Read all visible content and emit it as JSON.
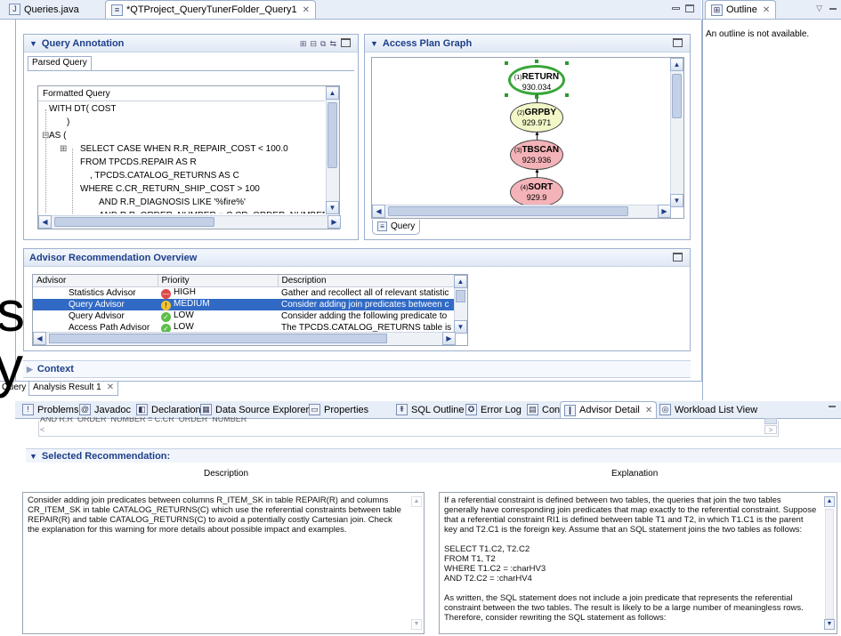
{
  "editor_tabs": [
    {
      "label": "Queries.java",
      "icon": "java-file-icon"
    },
    {
      "label": "*QTProject_QueryTunerFolder_Query1",
      "icon": "query-file-icon"
    }
  ],
  "outline": {
    "tab_label": "Outline",
    "message": "An outline is not available."
  },
  "query_annotation": {
    "title": "Query Annotation",
    "subtab": "Parsed Query",
    "formatted_title": "Formatted Query",
    "lines": [
      "WITH DT( COST",
      ")",
      "AS (",
      "SELECT CASE WHEN R.R_REPAIR_COST < 100.0",
      "FROM TPCDS.REPAIR AS R",
      ", TPCDS.CATALOG_RETURNS AS C",
      "WHERE C.CR_RETURN_SHIP_COST > 100",
      "AND R.R_DIAGNOSIS LIKE '%fire%'",
      "AND R.R_ORDER_NUMBER = C.CR_ORDER_NUMBER"
    ]
  },
  "access_plan": {
    "title": "Access Plan Graph",
    "tab_label": "Query",
    "nodes": [
      {
        "id": "(1)",
        "name": "RETURN",
        "cost": "930.034",
        "color": "#ffffff"
      },
      {
        "id": "(2)",
        "name": "GRPBY",
        "cost": "929.971",
        "color": "#f3f7c8"
      },
      {
        "id": "(3)",
        "name": "TBSCAN",
        "cost": "929.936",
        "color": "#f4b3b8"
      },
      {
        "id": "(4)",
        "name": "SORT",
        "cost": "929.9",
        "color": "#f4b3b8"
      }
    ]
  },
  "advisor_overview": {
    "title": "Advisor Recommendation Overview",
    "headers": [
      "Advisor",
      "Priority",
      "Description"
    ],
    "rows": [
      {
        "advisor": "Statistics Advisor",
        "priority": "HIGH",
        "icon": "high-priority-icon",
        "description": "Gather and recollect all of relevant statistic"
      },
      {
        "advisor": "Query Advisor",
        "priority": "MEDIUM",
        "icon": "medium-priority-icon",
        "description": "Consider adding join predicates between c"
      },
      {
        "advisor": "Query Advisor",
        "priority": "LOW",
        "icon": "low-priority-icon",
        "description": "Consider adding the following predicate to"
      },
      {
        "advisor": "Access Path Advisor",
        "priority": "LOW",
        "icon": "low-priority-icon",
        "description": "The TPCDS.CATALOG_RETURNS table is ac"
      }
    ]
  },
  "context": {
    "title": "Context"
  },
  "result_tabs": [
    "Query",
    "Analysis Result 1"
  ],
  "bottom_tabs": [
    {
      "label": "Problems",
      "icon": "problems-icon"
    },
    {
      "label": "Javadoc",
      "icon": "javadoc-icon"
    },
    {
      "label": "Declaration",
      "icon": "declaration-icon"
    },
    {
      "label": "Data Source Explorer",
      "icon": "data-source-icon"
    },
    {
      "label": "Properties",
      "icon": "properties-icon"
    },
    {
      "label": "SQL Outline",
      "icon": "sql-outline-icon"
    },
    {
      "label": "Error Log",
      "icon": "error-log-icon"
    },
    {
      "label": "Console",
      "icon": "console-icon"
    },
    {
      "label": "Advisor Detail",
      "icon": "advisor-detail-icon"
    },
    {
      "label": "Workload List View",
      "icon": "workload-icon"
    }
  ],
  "detail": {
    "cut_line": "AND R.R_ORDER_NUMBER = C.CR_ORDER_NUMBER",
    "title": "Selected Recommendation:",
    "desc_label": "Description",
    "expl_label": "Explanation",
    "description": "Consider adding join predicates between columns R_ITEM_SK in table REPAIR(R) and columns CR_ITEM_SK in table CATALOG_RETURNS(C) which use the referential constraints between table REPAIR(R) and table CATALOG_RETURNS(C) to avoid a potentially costly Cartesian join. Check the explanation for this warning for more details about possible impact and examples.",
    "explanation": [
      "If a referential constraint is defined between two tables, the queries that join the two tables generally have corresponding join predicates that map exactly to the referential constraint. Suppose that a referential constraint RI1 is defined between table T1 and T2, in which T1.C1 is the parent key and T2.C1 is the foreign key. Assume that an SQL statement joins the two tables as follows:",
      "SELECT T1.C2, T2.C2",
      "FROM T1, T2",
      "WHERE T1.C2 = :charHV3",
      "AND T2.C2 = :charHV4",
      "As written, the SQL statement does not include a join predicate that represents the referential constraint between the two tables. The result is likely to be a large number of meaningless rows. Therefore, consider rewriting the SQL statement as follows:"
    ]
  },
  "overlay_text": [
    "s",
    "y"
  ]
}
